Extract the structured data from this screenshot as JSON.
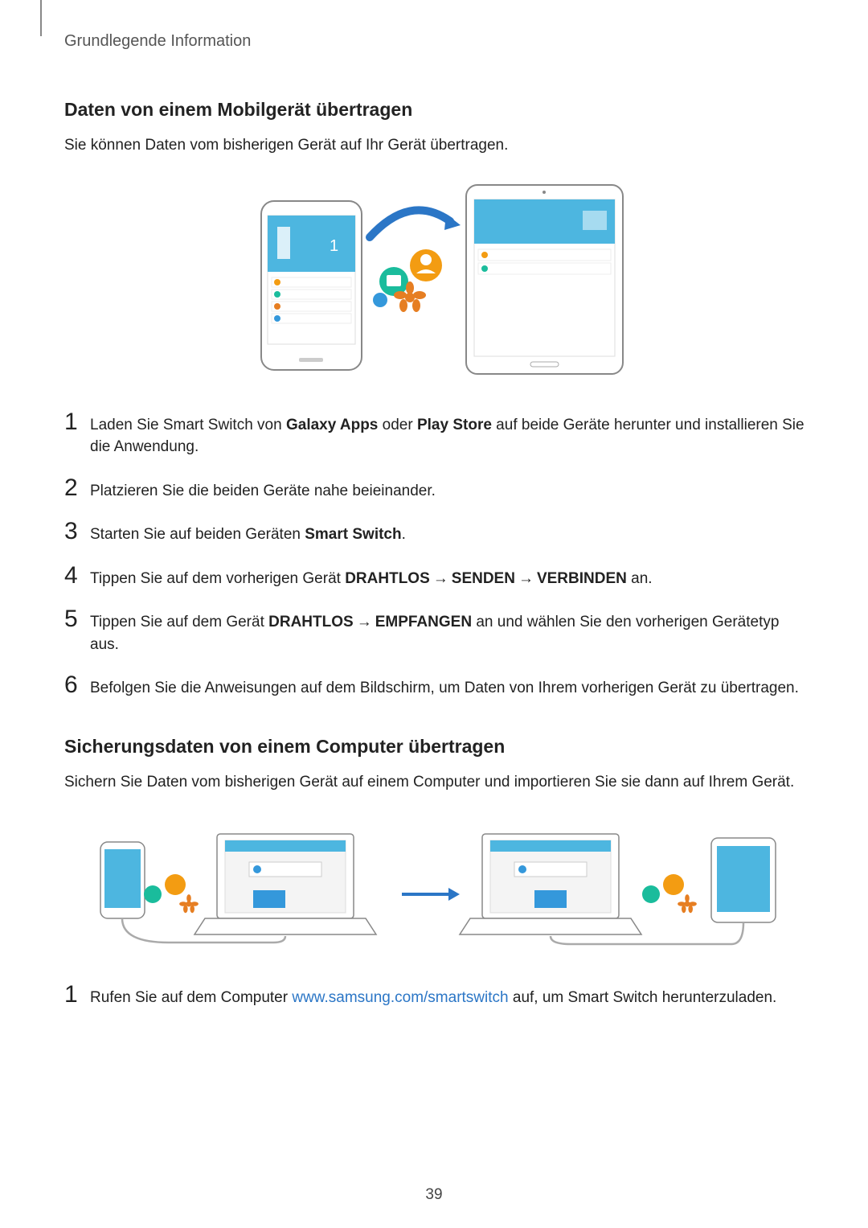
{
  "header": "Grundlegende Information",
  "section1": {
    "title": "Daten von einem Mobilgerät übertragen",
    "intro": "Sie können Daten vom bisherigen Gerät auf Ihr Gerät übertragen.",
    "illustration_alt": "Phone transferring data to tablet via Smart Switch",
    "steps": [
      {
        "num": "1",
        "pre": "Laden Sie Smart Switch von ",
        "b1": "Galaxy Apps",
        "mid1": " oder ",
        "b2": "Play Store",
        "post": " auf beide Geräte herunter und installieren Sie die Anwendung."
      },
      {
        "num": "2",
        "text": "Platzieren Sie die beiden Geräte nahe beieinander."
      },
      {
        "num": "3",
        "pre": "Starten Sie auf beiden Geräten ",
        "b1": "Smart Switch",
        "post": "."
      },
      {
        "num": "4",
        "pre": "Tippen Sie auf dem vorherigen Gerät ",
        "b1": "DRAHTLOS",
        "arrow1": "→",
        "b2": "SENDEN",
        "arrow2": "→",
        "b3": "VERBINDEN",
        "post": " an."
      },
      {
        "num": "5",
        "pre": "Tippen Sie auf dem Gerät ",
        "b1": "DRAHTLOS",
        "arrow1": "→",
        "b2": "EMPFANGEN",
        "post": " an und wählen Sie den vorherigen Gerätetyp aus."
      },
      {
        "num": "6",
        "text": "Befolgen Sie die Anweisungen auf dem Bildschirm, um Daten von Ihrem vorherigen Gerät zu übertragen."
      }
    ]
  },
  "section2": {
    "title": "Sicherungsdaten von einem Computer übertragen",
    "intro": "Sichern Sie Daten vom bisherigen Gerät auf einem Computer und importieren Sie sie dann auf Ihrem Gerät.",
    "illustration_alt": "Phone to laptop, then laptop to tablet via Smart Switch",
    "step1": {
      "num": "1",
      "pre": "Rufen Sie auf dem Computer ",
      "link_text": "www.samsung.com/smartswitch",
      "link_href": "http://www.samsung.com/smartswitch",
      "post": " auf, um Smart Switch herunterzuladen."
    }
  },
  "page_number": "39"
}
